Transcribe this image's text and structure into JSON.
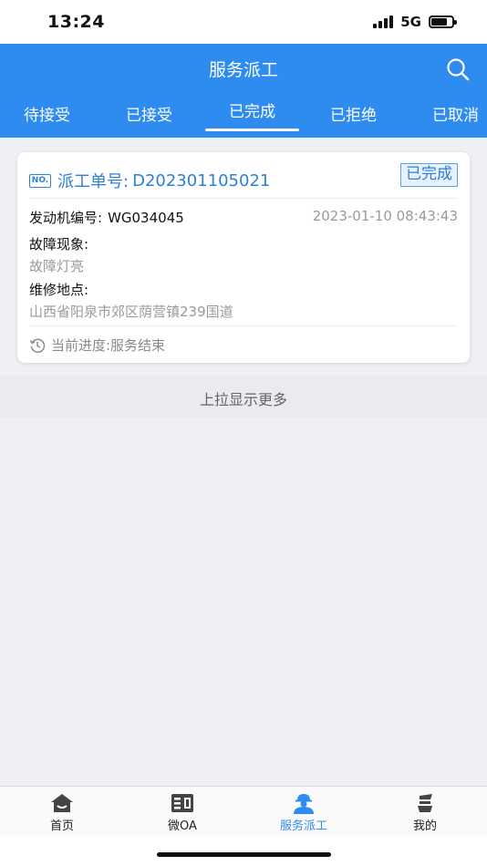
{
  "status_bar": {
    "time": "13:24",
    "network": "5G",
    "battery_level": 0.75
  },
  "header": {
    "title": "服务派工",
    "search_icon": "search-icon"
  },
  "tabs": [
    {
      "label": "待接受",
      "active": false
    },
    {
      "label": "已接受",
      "active": false
    },
    {
      "label": "已完成",
      "active": true
    },
    {
      "label": "已拒绝",
      "active": false
    },
    {
      "label": "已取消",
      "active": false
    }
  ],
  "card": {
    "no_badge": "NO.",
    "order_label": "派工单号:",
    "order_no": "D202301105021",
    "status": "已完成",
    "engine_label": "发动机编号:",
    "engine_no": "WG034045",
    "datetime": "2023-01-10 08:43:43",
    "fault_label": "故障现象:",
    "fault_value": "故障灯亮",
    "location_label": "维修地点:",
    "location_value": "山西省阳泉市郊区荫营镇239国道",
    "progress_icon": "history-icon",
    "progress_text": "当前进度:服务结束"
  },
  "load_more": "上拉显示更多",
  "bottom_nav": [
    {
      "label": "首页",
      "icon": "home-icon",
      "active": false
    },
    {
      "label": "微OA",
      "icon": "oa-book-icon",
      "active": false
    },
    {
      "label": "服务派工",
      "icon": "worker-helmet-icon",
      "active": true
    },
    {
      "label": "我的",
      "icon": "profile-stack-icon",
      "active": false
    }
  ],
  "colors": {
    "primary": "#2e8cf0",
    "card_accent": "#2e7fd6",
    "muted": "#9a9a9a"
  }
}
